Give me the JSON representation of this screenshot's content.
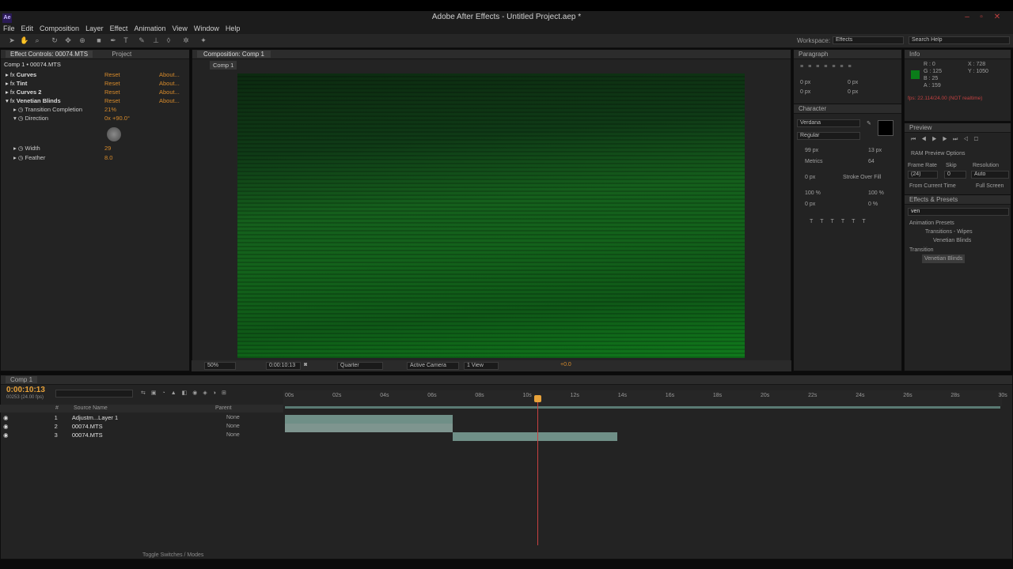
{
  "app": {
    "title": "Adobe After Effects - Untitled Project.aep *",
    "icon_label": "Ae"
  },
  "menu": [
    "File",
    "Edit",
    "Composition",
    "Layer",
    "Effect",
    "Animation",
    "View",
    "Window",
    "Help"
  ],
  "workspace": {
    "label": "Workspace:",
    "value": "Effects",
    "search_placeholder": "Search Help"
  },
  "effect_controls": {
    "tab": "Effect Controls: 00074.MTS",
    "tab2": "Project",
    "subtitle": "Comp 1 • 00074.MTS",
    "effects": [
      {
        "name": "Curves",
        "reset": "Reset",
        "about": "About..."
      },
      {
        "name": "Tint",
        "reset": "Reset",
        "about": "About..."
      },
      {
        "name": "Curves 2",
        "reset": "Reset",
        "about": "About..."
      },
      {
        "name": "Venetian Blinds",
        "reset": "Reset",
        "about": "About..."
      }
    ],
    "props": [
      {
        "name": "Transition Completion",
        "value": "21%"
      },
      {
        "name": "Direction",
        "value": "0x +90.0°"
      },
      {
        "name": "Width",
        "value": "29"
      },
      {
        "name": "Feather",
        "value": "8.0"
      }
    ]
  },
  "composition": {
    "tab": "Composition: Comp 1",
    "crumb": "Comp 1",
    "zoom": "50%",
    "timecode": "0:00:10:13",
    "resolution": "Quarter",
    "camera": "Active Camera",
    "views": "1 View",
    "exposure": "+0.0"
  },
  "paragraph": {
    "tab": "Paragraph",
    "fields": [
      "0 px",
      "0 px",
      "0 px",
      "0 px",
      "0 px"
    ]
  },
  "character": {
    "tab": "Character",
    "font": "Verdana",
    "style": "Regular",
    "size": "99 px",
    "leading": "13 px",
    "kerning": "Metrics",
    "tracking": "64",
    "stroke": "0 px",
    "stroke_mode": "Stroke Over Fill",
    "vscale": "100 %",
    "hscale": "100 %",
    "baseline": "0 px",
    "tsume": "0 %"
  },
  "info": {
    "tab": "Info",
    "r": "R : 0",
    "g": "G : 125",
    "b": "B : 25",
    "a": "A : 159",
    "x": "X : 728",
    "y": "Y : 1050",
    "status": "fps: 22.114/24.00 (NOT realtime)",
    "swatch": "#0a7d19"
  },
  "preview": {
    "tab": "Preview",
    "ram": "RAM Preview Options",
    "frame_rate_label": "Frame Rate",
    "skip_label": "Skip",
    "resolution_label": "Resolution",
    "frame_rate": "(24)",
    "skip": "0",
    "resolution": "Auto",
    "from_current": "From Current Time",
    "full_screen": "Full Screen"
  },
  "effects_presets": {
    "tab": "Effects & Presets",
    "search": "ven",
    "tree": [
      "Animation Presets",
      "Transitions - Wipes",
      "Venetian Blinds",
      "Transition",
      "Venetian Blinds"
    ]
  },
  "timeline": {
    "tab": "Comp 1",
    "timecode": "0:00:10:13",
    "fps": "00253 (24.00 fps)",
    "col_num": "#",
    "col_source": "Source Name",
    "col_parent": "Parent",
    "layers": [
      {
        "num": "1",
        "name": "Adjustm...Layer 1",
        "parent": "None"
      },
      {
        "num": "2",
        "name": "00074.MTS",
        "parent": "None"
      },
      {
        "num": "3",
        "name": "00074.MTS",
        "parent": "None"
      }
    ],
    "ticks": [
      "00s",
      "02s",
      "04s",
      "06s",
      "08s",
      "10s",
      "12s",
      "14s",
      "16s",
      "18s",
      "20s",
      "22s",
      "24s",
      "26s",
      "28s",
      "30s"
    ],
    "toggle": "Toggle Switches / Modes",
    "accent": "#e8a23a",
    "playhead_color": "#c84040"
  }
}
